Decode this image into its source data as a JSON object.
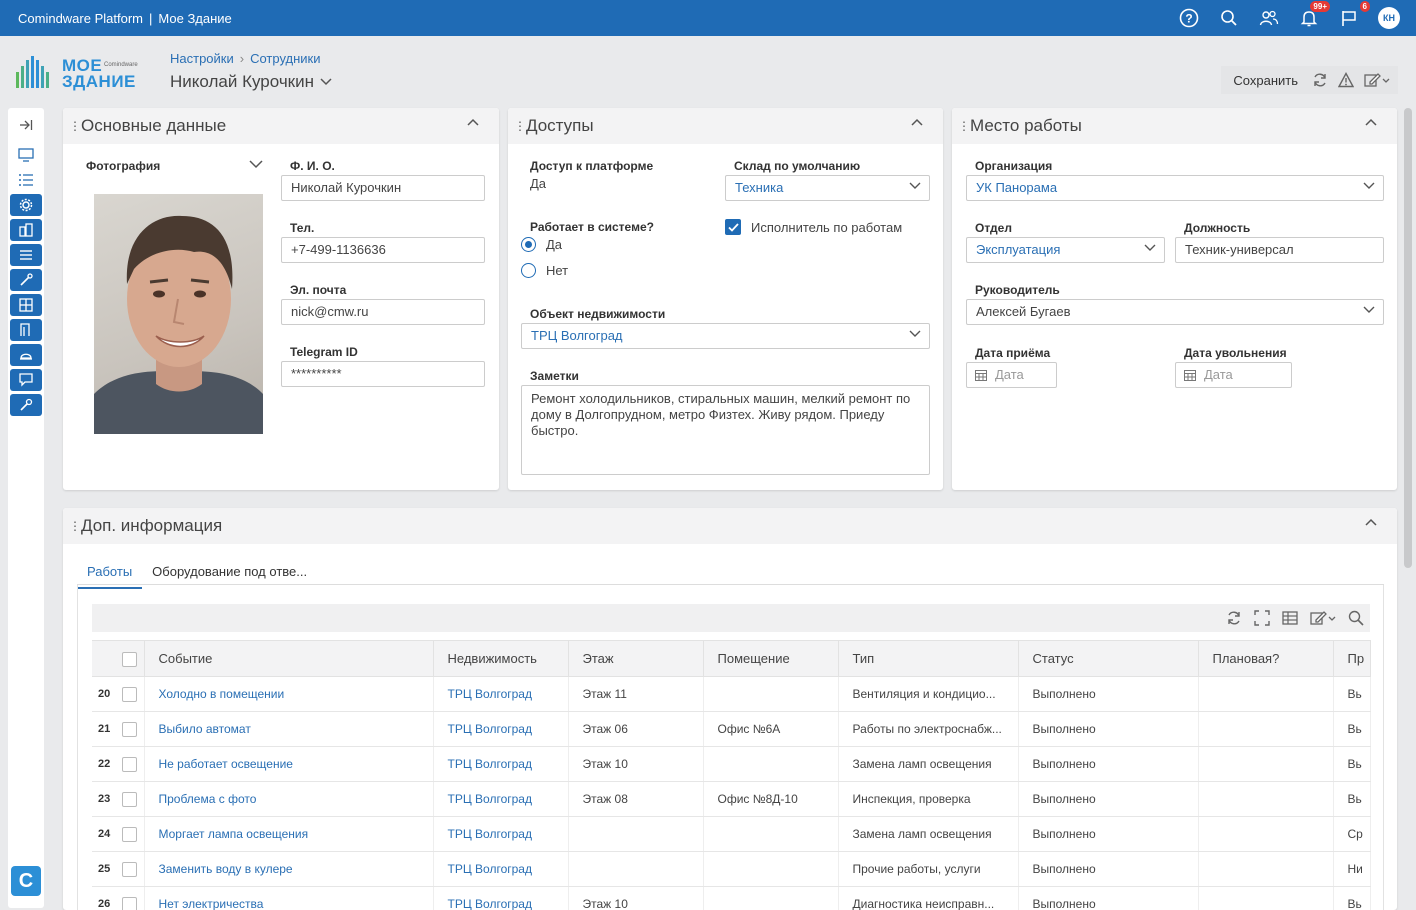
{
  "app": {
    "platform": "Comindware Platform",
    "app_name": "Мое Здание",
    "notifications_badge": "99+",
    "flags_badge": "6",
    "user_initials": "КН"
  },
  "logo": {
    "line1": "МОЕ",
    "line2": "ЗДАНИЕ",
    "brand_small": "Comindware"
  },
  "breadcrumb": [
    "Настройки",
    "Сотрудники"
  ],
  "page_title": "Николай Курочкин",
  "header_actions": {
    "save_label": "Сохранить"
  },
  "panels": {
    "main": {
      "title": "Основные данные",
      "photo_label": "Фотография",
      "fio_label": "Ф. И. О.",
      "fio_value": "Николай Курочкин",
      "phone_label": "Тел.",
      "phone_value": "+7-499-1136636",
      "email_label": "Эл. почта",
      "email_value": "nick@cmw.ru",
      "telegram_label": "Telegram ID",
      "telegram_value": "**********"
    },
    "access": {
      "title": "Доступы",
      "platform_access_label": "Доступ к платформе",
      "platform_access_value": "Да",
      "warehouse_label": "Склад по умолчанию",
      "warehouse_value": "Техника",
      "works_in_system_label": "Работает в системе?",
      "radio_yes": "Да",
      "radio_no": "Нет",
      "executor_label": "Исполнитель по работам",
      "property_label": "Объект недвижимости",
      "property_value": "ТРЦ Волгоград",
      "notes_label": "Заметки",
      "notes_value": "Ремонт холодильников, стиральных машин, мелкий ремонт по дому в Долгопрудном, метро Физтех. Живу рядом. Приеду быстро."
    },
    "workplace": {
      "title": "Место работы",
      "org_label": "Организация",
      "org_value": "УК Панорама",
      "dept_label": "Отдел",
      "dept_value": "Эксплуатация",
      "position_label": "Должность",
      "position_value": "Техник-универсал",
      "manager_label": "Руководитель",
      "manager_value": "Алексей Бугаев",
      "hire_label": "Дата приёма",
      "hire_placeholder": "Дата",
      "fire_label": "Дата увольнения",
      "fire_placeholder": "Дата"
    },
    "extra": {
      "title": "Доп. информация",
      "tabs": [
        "Работы",
        "Оборудование под отве..."
      ],
      "columns": [
        "Событие",
        "Недвижимость",
        "Этаж",
        "Помещение",
        "Тип",
        "Статус",
        "Плановая?",
        "Пр"
      ],
      "rows": [
        {
          "n": "20",
          "event": "Холодно в помещении",
          "property": "ТРЦ Волгоград",
          "floor": "Этаж 11",
          "room": "",
          "type": "Вентиляция и кондицио...",
          "status": "Выполнено",
          "planned": "",
          "extra": "Вь"
        },
        {
          "n": "21",
          "event": "Выбило автомат",
          "property": "ТРЦ Волгоград",
          "floor": "Этаж 06",
          "room": "Офис №6А",
          "type": "Работы по электроснабж...",
          "status": "Выполнено",
          "planned": "",
          "extra": "Вь"
        },
        {
          "n": "22",
          "event": "Не работает освещение",
          "property": "ТРЦ Волгоград",
          "floor": "Этаж 10",
          "room": "",
          "type": "Замена ламп освещения",
          "status": "Выполнено",
          "planned": "",
          "extra": "Вь"
        },
        {
          "n": "23",
          "event": "Проблема с фото",
          "property": "ТРЦ Волгоград",
          "floor": "Этаж 08",
          "room": "Офис №8Д-10",
          "type": "Инспекция, проверка",
          "status": "Выполнено",
          "planned": "",
          "extra": "Вь"
        },
        {
          "n": "24",
          "event": "Моргает лампа освещения",
          "property": "ТРЦ Волгоград",
          "floor": "",
          "room": "",
          "type": "Замена ламп освещения",
          "status": "Выполнено",
          "planned": "",
          "extra": "Ср"
        },
        {
          "n": "25",
          "event": "Заменить воду в кулере",
          "property": "ТРЦ Волгоград",
          "floor": "",
          "room": "",
          "type": "Прочие работы, услуги",
          "status": "Выполнено",
          "planned": "",
          "extra": "Ни"
        },
        {
          "n": "26",
          "event": "Нет электричества",
          "property": "ТРЦ Волгоград",
          "floor": "Этаж 10",
          "room": "",
          "type": "Диагностика неисправн...",
          "status": "Выполнено",
          "planned": "",
          "extra": "Вь"
        }
      ]
    }
  },
  "colors": {
    "primary": "#1f6bb5",
    "link": "#2a6fb4",
    "badge": "#e53935"
  }
}
